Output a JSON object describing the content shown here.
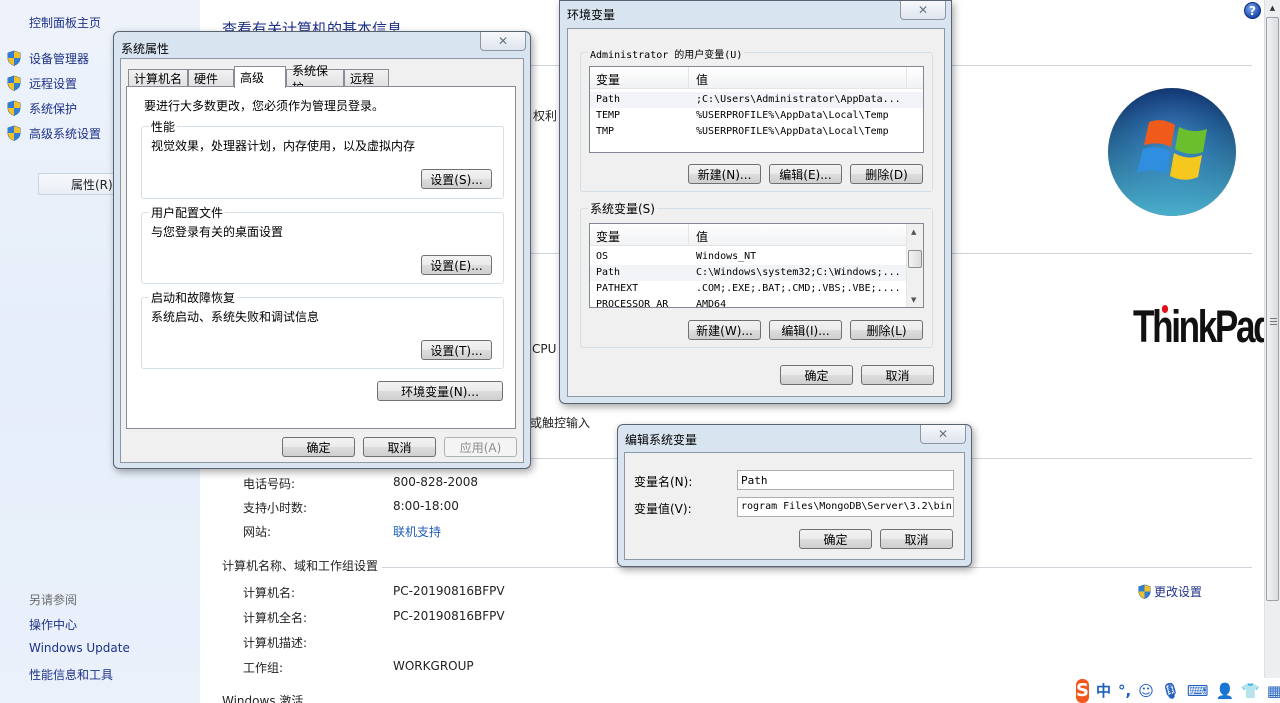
{
  "left_pane": {
    "home": "控制面板主页",
    "items": [
      {
        "label": "设备管理器",
        "icon": "uac-shield-icon"
      },
      {
        "label": "远程设置",
        "icon": "uac-shield-icon"
      },
      {
        "label": "系统保护",
        "icon": "uac-shield-icon"
      },
      {
        "label": "高级系统设置",
        "icon": "uac-shield-icon"
      }
    ],
    "see_also": "另请参阅",
    "links": [
      "操作中心",
      "Windows Update",
      "性能信息和工具"
    ]
  },
  "context_menu": {
    "item": "属性(R)"
  },
  "main": {
    "title": "查看有关计算机的基本信息",
    "peek_texts": [
      "权利",
      "CPU",
      "或触控输入"
    ],
    "support": {
      "rows": [
        {
          "label": "电话号码:",
          "value": "800-828-2008"
        },
        {
          "label": "支持小时数:",
          "value": "8:00-18:00"
        },
        {
          "label": "网站:",
          "value": "联机支持",
          "is_link": true
        }
      ]
    },
    "computer_section": {
      "heading": "计算机名称、域和工作组设置",
      "rows": [
        {
          "label": "计算机名:",
          "value": "PC-20190816BFPV"
        },
        {
          "label": "计算机全名:",
          "value": "PC-20190816BFPV"
        },
        {
          "label": "计算机描述:",
          "value": ""
        },
        {
          "label": "工作组:",
          "value": "WORKGROUP"
        }
      ],
      "change_settings": "更改设置"
    },
    "activation_heading": "Windows 激活",
    "help_icon": "?",
    "oem_logo": "ThinkPad"
  },
  "system_properties": {
    "title": "系统属性",
    "close": "✕",
    "tabs": [
      "计算机名",
      "硬件",
      "高级",
      "系统保护",
      "远程"
    ],
    "active_tab": "高级",
    "admin_note": "要进行大多数更改，您必须作为管理员登录。",
    "groups": [
      {
        "legend": "性能",
        "desc": "视觉效果，处理器计划，内存使用，以及虚拟内存",
        "button": "设置(S)..."
      },
      {
        "legend": "用户配置文件",
        "desc": "与您登录有关的桌面设置",
        "button": "设置(E)..."
      },
      {
        "legend": "启动和故障恢复",
        "desc": "系统启动、系统失败和调试信息",
        "button": "设置(T)..."
      }
    ],
    "env_button": "环境变量(N)...",
    "ok": "确定",
    "cancel": "取消",
    "apply": "应用(A)"
  },
  "env_vars": {
    "title": "环境变量",
    "close": "✕",
    "user_group": "Administrator 的用户变量(U)",
    "col_var": "变量",
    "col_val": "值",
    "user_vars": [
      {
        "name": "Path",
        "value": ";C:\\Users\\Administrator\\AppData..."
      },
      {
        "name": "TEMP",
        "value": "%USERPROFILE%\\AppData\\Local\\Temp"
      },
      {
        "name": "TMP",
        "value": "%USERPROFILE%\\AppData\\Local\\Temp"
      }
    ],
    "user_buttons": [
      "新建(N)...",
      "编辑(E)...",
      "删除(D)"
    ],
    "sys_group": "系统变量(S)",
    "sys_vars": [
      {
        "name": "OS",
        "value": "Windows_NT"
      },
      {
        "name": "Path",
        "value": "C:\\Windows\\system32;C:\\Windows;..."
      },
      {
        "name": "PATHEXT",
        "value": ".COM;.EXE;.BAT;.CMD;.VBS;.VBE;...."
      },
      {
        "name": "PROCESSOR_AR",
        "value": "AMD64"
      }
    ],
    "sys_buttons": [
      "新建(W)...",
      "编辑(I)...",
      "删除(L)"
    ],
    "ok": "确定",
    "cancel": "取消"
  },
  "edit_var": {
    "title": "编辑系统变量",
    "close": "✕",
    "name_label": "变量名(N):",
    "name_value": "Path",
    "value_label": "变量值(V):",
    "value_value": "rogram Files\\MongoDB\\Server\\3.2\\bin",
    "ok": "确定",
    "cancel": "取消"
  },
  "tray": {
    "ime_logo": "S",
    "ime_mode": "中",
    "punct": "°,",
    "icons": [
      "emoji-icon",
      "microphone-icon",
      "keyboard-icon",
      "user-icon",
      "skin-icon",
      "toolbox-icon"
    ]
  }
}
